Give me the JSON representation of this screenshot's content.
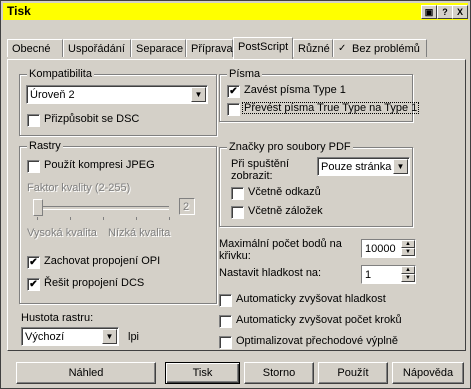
{
  "window": {
    "title": "Tisk",
    "help_btn": "?",
    "close_btn": "X",
    "sys_btn": "▣"
  },
  "tabs": [
    "Obecné",
    "Uspořádání",
    "Separace",
    "Příprava",
    "PostScript",
    "Různé",
    "Bez problémů"
  ],
  "compat": {
    "title": "Kompatibilita",
    "level": "Úroveň 2",
    "dsc_label": "Přizpůsobit se DSC",
    "dsc_checked": false
  },
  "raster": {
    "title": "Rastry",
    "jpeg_label": "Použít kompresi JPEG",
    "jpeg_checked": false,
    "quality_label": "Faktor kvality (2-255)",
    "quality_value": "2",
    "high_label": "Vysoká kvalita",
    "low_label": "Nízká kvalita",
    "opi_label": "Zachovat propojení OPI",
    "opi_checked": true,
    "dcs_label": "Řešit propojení DCS",
    "dcs_checked": true
  },
  "density": {
    "label": "Hustota rastru:",
    "value": "Výchozí",
    "unit": "lpi"
  },
  "fonts": {
    "title": "Písma",
    "embed_label": "Zavést písma Type 1",
    "embed_checked": true,
    "convert_label": "Převést písma True Type na Type 1",
    "convert_checked": false
  },
  "pdf": {
    "title": "Značky pro soubory PDF",
    "on_start_label": "Při spuštění zobrazit:",
    "on_start_value": "Pouze stránka",
    "links_label": "Včetně odkazů",
    "links_checked": false,
    "bookmarks_label": "Včetně záložek",
    "bookmarks_checked": false
  },
  "curve": {
    "max_points_label": "Maximální počet bodů na křivku:",
    "max_points_value": "10000",
    "flatness_label": "Nastavit hladkost na:",
    "flatness_value": "1",
    "auto_flat_label": "Automaticky zvyšovat hladkost",
    "auto_steps_label": "Automaticky zvyšovat počet kroků",
    "optimize_label": "Optimalizovat přechodové výplně"
  },
  "buttons": {
    "preview": "Náhled",
    "print": "Tisk",
    "cancel": "Storno",
    "apply": "Použít",
    "help": "Nápověda"
  }
}
